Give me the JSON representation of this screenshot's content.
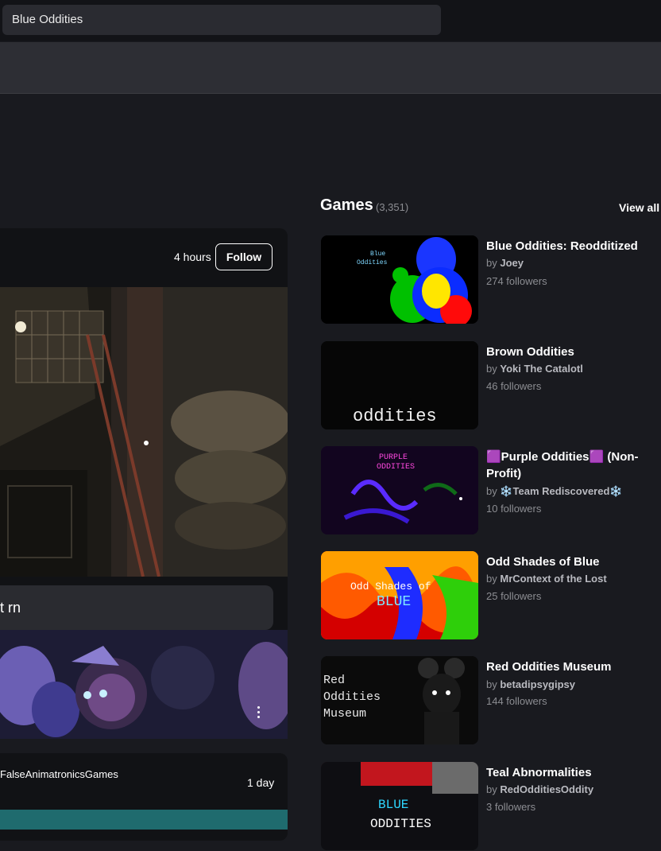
{
  "search": {
    "value": "Blue Oddities"
  },
  "feed": {
    "post1": {
      "time": "4 hours",
      "follow_label": "Follow",
      "caption": "t rn"
    },
    "post2": {
      "author": "FalseAnimatronicsGames",
      "time": "1 day"
    }
  },
  "games": {
    "title": "Games",
    "count": "(3,351)",
    "view_all": "View all",
    "items": [
      {
        "title": "Blue Oddities: Reodditized",
        "by": "by",
        "author": "Joey",
        "followers": "274 followers",
        "thumb_text": "Blue Oddities"
      },
      {
        "title": "Brown Oddities",
        "by": "by",
        "author": "Yoki The Catalotl",
        "followers": "46 followers",
        "thumb_text": "oddities"
      },
      {
        "title": "🟪Purple Oddities🟪 (Non-Profit)",
        "by": "by",
        "author": "❄️Team Rediscovered❄️",
        "followers": "10 followers",
        "thumb_text": "PURPLE ODDITIES"
      },
      {
        "title": "Odd Shades of Blue",
        "by": "by",
        "author": "MrContext of the Lost",
        "followers": "25 followers",
        "thumb_text": "Odd Shades of BLUE"
      },
      {
        "title": "Red Oddities Museum",
        "by": "by",
        "author": "betadipsygipsy",
        "followers": "144 followers",
        "thumb_text": "Red Oddities Museum"
      },
      {
        "title": "Teal Abnormalities",
        "by": "by",
        "author": "RedOdditiesOddity",
        "followers": "3 followers",
        "thumb_text": "BLUE ODDITIES"
      }
    ]
  }
}
